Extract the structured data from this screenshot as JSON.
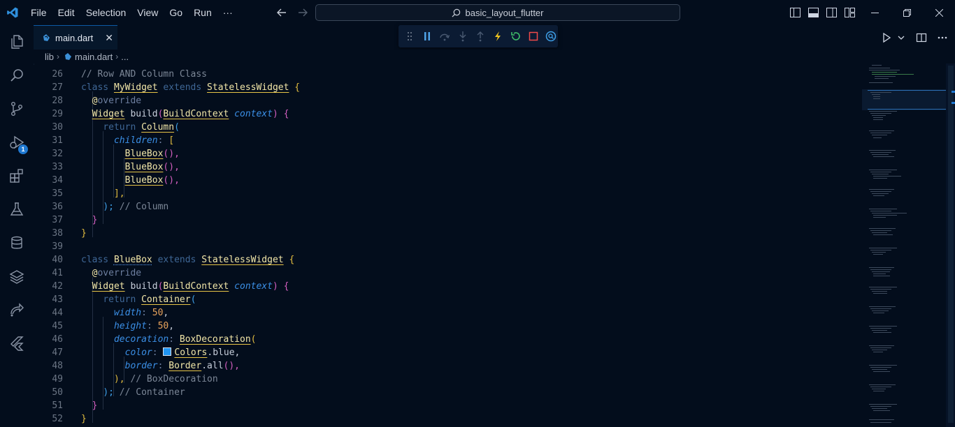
{
  "menu": [
    "File",
    "Edit",
    "Selection",
    "View",
    "Go",
    "Run",
    "···"
  ],
  "search": {
    "text": "basic_layout_flutter"
  },
  "tab": {
    "label": "main.dart",
    "close": "✕"
  },
  "breadcrumb": {
    "folder": "lib",
    "file": "main.dart",
    "more": "..."
  },
  "activity": {
    "debug_badge": "1"
  },
  "colors": {
    "accent": "#1f78d1",
    "background": "#030d1c"
  },
  "icons": [
    "vscode-logo-icon",
    "explorer-icon",
    "search-icon",
    "source-control-icon",
    "run-debug-icon",
    "extensions-icon",
    "testing-icon",
    "database-icon",
    "layers-icon",
    "remote-icon",
    "flutter-icon",
    "pause-icon",
    "step-over-icon",
    "step-into-icon",
    "step-out-icon",
    "hot-reload-icon",
    "hot-restart-icon",
    "stop-icon",
    "devtools-icon"
  ],
  "code": {
    "line_numbers": [
      "26",
      "27",
      "28",
      "29",
      "30",
      "31",
      "32",
      "33",
      "34",
      "35",
      "36",
      "37",
      "38",
      "39",
      "40",
      "41",
      "42",
      "43",
      "44",
      "45",
      "46",
      "47",
      "48",
      "49",
      "50",
      "51",
      "52"
    ],
    "tokens": {
      "l26": "// Row AND Column Class",
      "l27_kw": "class",
      "l27_name": "MyWidget",
      "l27_ext": "extends",
      "l27_base": "StatelessWidget",
      "l27_brace": "{",
      "l28_at": "@",
      "l28_override": "override",
      "l29_type": "Widget",
      "l29_fn": "build",
      "l29_paren": "(",
      "l29_ptype": "BuildContext",
      "l29_param": "context",
      "l29_close": ")",
      "l29_brace": "{",
      "l30_kw": "return",
      "l30_type": "Column",
      "l30_paren": "(",
      "l31_param": "children",
      "l31_colon": ":",
      "l31_bracket": "[",
      "l32_type": "BlueBox",
      "l32_punc": "(),",
      "l33_type": "BlueBox",
      "l33_punc": "(),",
      "l34_type": "BlueBox",
      "l34_punc": "(),",
      "l35_bracket": "],",
      "l36_paren": ");",
      "l36_comment": "// Column",
      "l37_brace": "}",
      "l38_brace": "}",
      "l40_kw": "class",
      "l40_name": "BlueBox",
      "l40_ext": "extends",
      "l40_base": "StatelessWidget",
      "l40_brace": "{",
      "l41_at": "@",
      "l41_override": "override",
      "l42_type": "Widget",
      "l42_fn": "build",
      "l42_paren": "(",
      "l42_ptype": "BuildContext",
      "l42_param": "context",
      "l42_close": ")",
      "l42_brace": "{",
      "l43_kw": "return",
      "l43_type": "Container",
      "l43_paren": "(",
      "l44_param": "width",
      "l44_colon": ":",
      "l44_num": "50",
      "l44_comma": ",",
      "l45_param": "height",
      "l45_colon": ":",
      "l45_num": "50",
      "l45_comma": ",",
      "l46_param": "decoration",
      "l46_colon": ":",
      "l46_type": "BoxDecoration",
      "l46_paren": "(",
      "l47_param": "color",
      "l47_colon": ":",
      "l47_type": "Colors",
      "l47_rest": ".blue,",
      "l48_param": "border",
      "l48_colon": ":",
      "l48_type": "Border",
      "l48_rest": ".all",
      "l48_punc": "(),",
      "l49_paren": "),",
      "l49_comment": "// BoxDecoration",
      "l50_paren": ");",
      "l50_comment": "// Container",
      "l51_brace": "}",
      "l52_brace": "}"
    }
  }
}
